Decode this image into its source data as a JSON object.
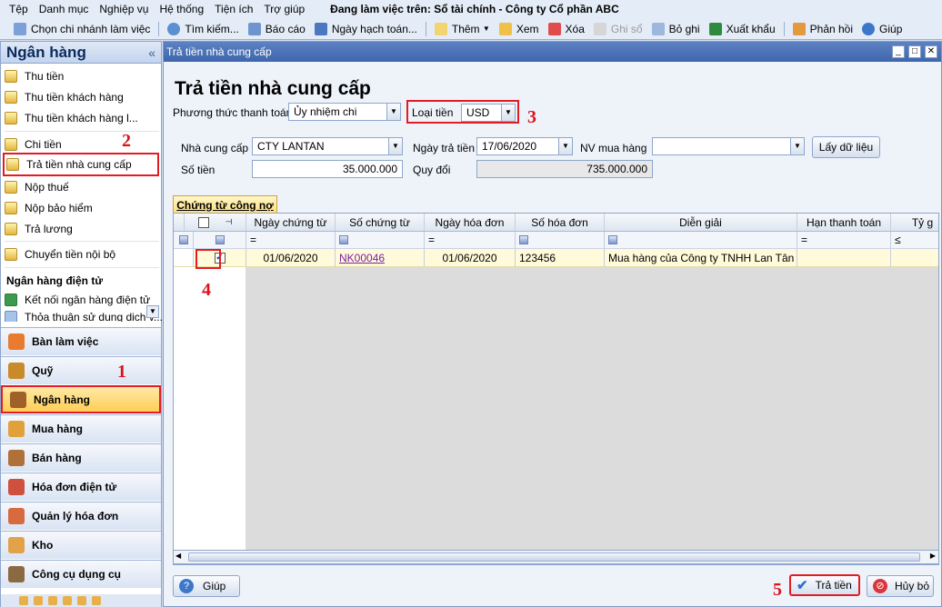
{
  "menu": {
    "items": [
      "Tệp",
      "Danh mục",
      "Nghiệp vụ",
      "Hệ thống",
      "Tiện ích",
      "Trợ giúp"
    ],
    "context": "Đang làm việc trên: Sổ tài chính - Công ty Cổ phần ABC"
  },
  "toolbar": {
    "branch": "Chọn chi nhánh làm việc",
    "search": "Tìm kiếm...",
    "report": "Báo cáo",
    "date": "Ngày hạch toán...",
    "add": "Thêm",
    "view": "Xem",
    "delete": "Xóa",
    "post": "Ghi sổ",
    "unpost": "Bỏ ghi",
    "export": "Xuất khẩu",
    "feedback": "Phản hồi",
    "help": "Giúp"
  },
  "sidebar": {
    "title": "Ngân hàng",
    "collapse": "«",
    "items": [
      "Thu tiền",
      "Thu tiền khách hàng",
      "Thu tiền khách hàng l...",
      "Chi tiền",
      "Trả tiền nhà cung cấp",
      "Nộp thuế",
      "Nộp bảo hiểm",
      "Trả lương",
      "Chuyển tiền nội bộ"
    ],
    "section": "Ngân hàng điện tử",
    "ebank_items": [
      "Kết nối ngân hàng điện tử",
      "Thỏa thuận sử dụng dịch v..."
    ],
    "nav": [
      "Bàn làm việc",
      "Quỹ",
      "Ngân hàng",
      "Mua hàng",
      "Bán hàng",
      "Hóa đơn điện tử",
      "Quản lý hóa đơn",
      "Kho",
      "Công cụ dụng cụ"
    ]
  },
  "window": {
    "title": "Trả tiền nhà cung cấp",
    "min": "_",
    "restore": "□",
    "close": "✕"
  },
  "form": {
    "heading": "Trả tiền nhà cung cấp",
    "method_label": "Phương thức thanh toán",
    "method_value": "Ủy nhiệm chi",
    "currency_label": "Loại tiền",
    "currency_value": "USD",
    "supplier_label": "Nhà cung cấp",
    "supplier_value": "CTY LANTAN",
    "paydate_label": "Ngày trả tiền",
    "paydate_value": "17/06/2020",
    "staff_label": "NV mua hàng",
    "staff_value": "",
    "fetch_button": "Lấy dữ liệu",
    "amount_label": "Số tiền",
    "amount_value": "35.000.000",
    "converted_label": "Quy đổi",
    "converted_value": "735.000.000"
  },
  "tab": "Chứng từ công nợ",
  "grid": {
    "columns": [
      "Ngày chứng từ",
      "Số chứng từ",
      "Ngày hóa đơn",
      "Số hóa đơn",
      "Diễn giải",
      "Hạn thanh toán",
      "Tỷ g"
    ],
    "filters": [
      "=",
      "=",
      "=",
      "=",
      "=",
      "≤"
    ],
    "rows": [
      {
        "checked": "✓",
        "doc_date": "01/06/2020",
        "doc_no": "NK00046",
        "inv_date": "01/06/2020",
        "inv_no": "123456",
        "desc": "Mua hàng của Công ty TNHH Lan Tân t",
        "due": "",
        "rate": ""
      }
    ]
  },
  "buttons": {
    "help": "Giúp",
    "pay": "Trả tiền",
    "cancel": "Hủy bỏ"
  },
  "annotations": [
    "1",
    "2",
    "3",
    "4",
    "5"
  ],
  "colors": {
    "highlight": "#e31b23",
    "title_bar": "#3e66ad",
    "selected_row": "#fffad9"
  }
}
